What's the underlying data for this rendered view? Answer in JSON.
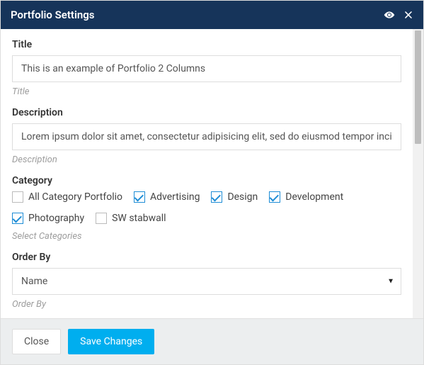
{
  "header": {
    "title": "Portfolio Settings"
  },
  "fields": {
    "title": {
      "label": "Title",
      "value": "This is an example of Portfolio 2 Columns",
      "help": "Title"
    },
    "description": {
      "label": "Description",
      "value": "Lorem ipsum dolor sit amet, consectetur adipisicing elit, sed do eiusmod tempor incididu",
      "help": "Description"
    },
    "category": {
      "label": "Category",
      "help": "Select Categories",
      "options": {
        "all": {
          "label": "All Category Portfolio",
          "checked": false
        },
        "advertising": {
          "label": "Advertising",
          "checked": true
        },
        "design": {
          "label": "Design",
          "checked": true
        },
        "development": {
          "label": "Development",
          "checked": true
        },
        "photography": {
          "label": "Photography",
          "checked": true
        },
        "swstabwall": {
          "label": "SW stabwall",
          "checked": false
        }
      }
    },
    "orderby": {
      "label": "Order By",
      "value": "Name",
      "help": "Order By"
    }
  },
  "footer": {
    "close": "Close",
    "save": "Save Changes"
  }
}
